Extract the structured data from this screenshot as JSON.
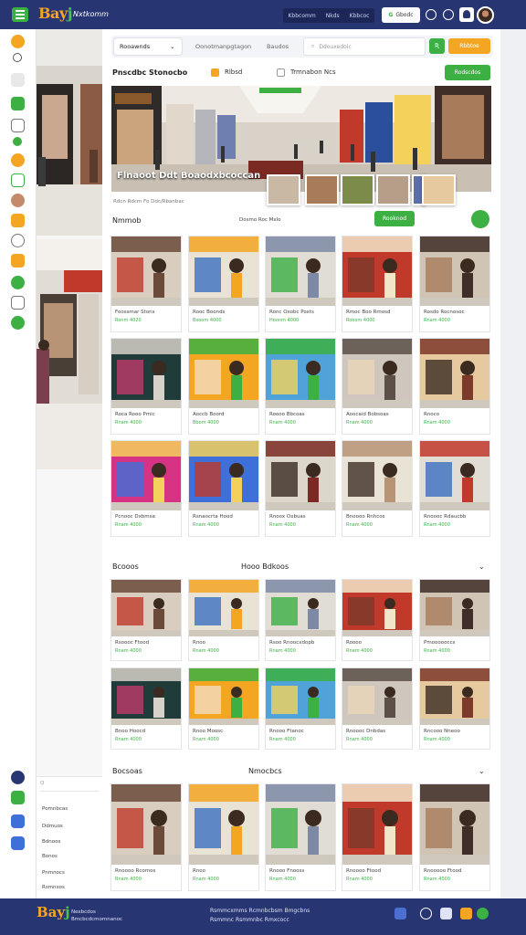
{
  "header": {
    "logo_main": "Bay",
    "logo_j": "j",
    "logo_sub": "Nxtkomm",
    "nav": [
      "Kbbcomm",
      "Nkds",
      "Kbbcoc"
    ],
    "pill_label": "Gbodc",
    "pill_mark": "G"
  },
  "toolbar": {
    "tabs": [
      "Rooawnds",
      "Oonotmanpgtagon",
      "Baudos"
    ],
    "search_placeholder": "Ddouxedoic",
    "search_button": "Ʀ",
    "orange_button": "Rbbtoe"
  },
  "filters": {
    "title": "Pnscdbc Stonocbo",
    "option_a": "Rlbsd",
    "option_b": "Trmnabon Ncs",
    "button": "Rodscdos"
  },
  "hero": {
    "caption": "Flnaoot Ddt Boaodxbcoccan",
    "meta": "Rdcn Rdcm Fo Ddc/Rbanbac"
  },
  "section1": {
    "title": "Nmmob",
    "meta": "Dosmo Roc Mxlo",
    "button": "Rooknod"
  },
  "section2": {
    "title": "Bcooos",
    "title2": "Hooo Bdkoos"
  },
  "section3": {
    "title": "Bocsoas",
    "title2": "Nmocbcs"
  },
  "grid1": [
    {
      "l1": "Foossmar Stons",
      "l2": "Ronm 4020"
    },
    {
      "l1": "Rooc Boonds",
      "l2": "Bxoom 4000"
    },
    {
      "l1": "Ronc Oxobc Poxts",
      "l2": "Hoonm 4000"
    },
    {
      "l1": "Rmoc Boo Rmosd",
      "l2": "Rooom 4000"
    },
    {
      "l1": "Rosdo Rocnosoc",
      "l2": "Rnam 4000"
    },
    {
      "l1": "Roca Rooo Pmic",
      "l2": "Rnam 4000"
    },
    {
      "l1": "Aoccb Boord",
      "l2": "Bbom 4000"
    },
    {
      "l1": "Roooo Bbcoas",
      "l2": "Rnam 4000"
    },
    {
      "l1": "Aoocaid Bobsoas",
      "l2": "Rnam 4000"
    },
    {
      "l1": "Rnoco",
      "l2": "Rnam 4000"
    },
    {
      "l1": "Pcnooc Dxbmsa",
      "l2": "Rnam 4000"
    },
    {
      "l1": "Rsnaocrta Hood",
      "l2": "Rnam 4000"
    },
    {
      "l1": "Rnoox Oxbuas",
      "l2": "Rnam 4000"
    },
    {
      "l1": "Bnoooo Rnhcos",
      "l2": "Rnam 4000"
    },
    {
      "l1": "Rnoooc Rdaucbb",
      "l2": "Rnam 4000"
    }
  ],
  "grid2": [
    {
      "l1": "Rsoooc Ftood",
      "l2": "Rnam 4000"
    },
    {
      "l1": "Rnoo",
      "l2": "Rnam 4000"
    },
    {
      "l1": "Rsoo Rnoocxdopb",
      "l2": "Rnam 4000"
    },
    {
      "l1": "Roooo",
      "l2": "Rnam 4000"
    },
    {
      "l1": "Pmoooooccs",
      "l2": "Rnam 4000"
    },
    {
      "l1": "Bnoo Hoocd",
      "l2": "Rnam 4000"
    },
    {
      "l1": "Rnoo Moosc",
      "l2": "Rnam 4000"
    },
    {
      "l1": "Rnooo Ftanoc",
      "l2": "Rnam 4000"
    },
    {
      "l1": "Rnoooc Dnbdas",
      "l2": "Rnam 4000"
    },
    {
      "l1": "Rncooo Nneoo",
      "l2": "Rnam 4000"
    }
  ],
  "grid3": [
    {
      "l1": "Rnoooo Rcomos",
      "l2": "Rnam 4000"
    },
    {
      "l1": "Rnoo",
      "l2": "Rnam 4000"
    },
    {
      "l1": "Rnooo Fnooss",
      "l2": "Rnam 4000"
    },
    {
      "l1": "Rnoooo Ftood",
      "l2": "Rnam 4000"
    },
    {
      "l1": "Rnooooo Ftood",
      "l2": "Rnam 4000"
    }
  ],
  "left_panel": {
    "search": "Q",
    "items": [
      "Pomnbcas",
      "Ddmuos",
      "Bdnoos",
      "Bonos",
      "Pnmnocs",
      "Rsmnxos"
    ]
  },
  "footer": {
    "logo_main": "Bay",
    "logo_j": "j",
    "sub1": "Nexbcdos",
    "sub2": "Bmcbcdcmomnanoc",
    "line1": "Rsmmcxmms Rcmnbcbsm Bmgcbns",
    "line2": "Rsmmnc Rsmmnbc Rmxcocc"
  },
  "colors": {
    "navy": "#283573",
    "green": "#3cb043",
    "orange": "#f4a623",
    "red": "#e53935"
  }
}
